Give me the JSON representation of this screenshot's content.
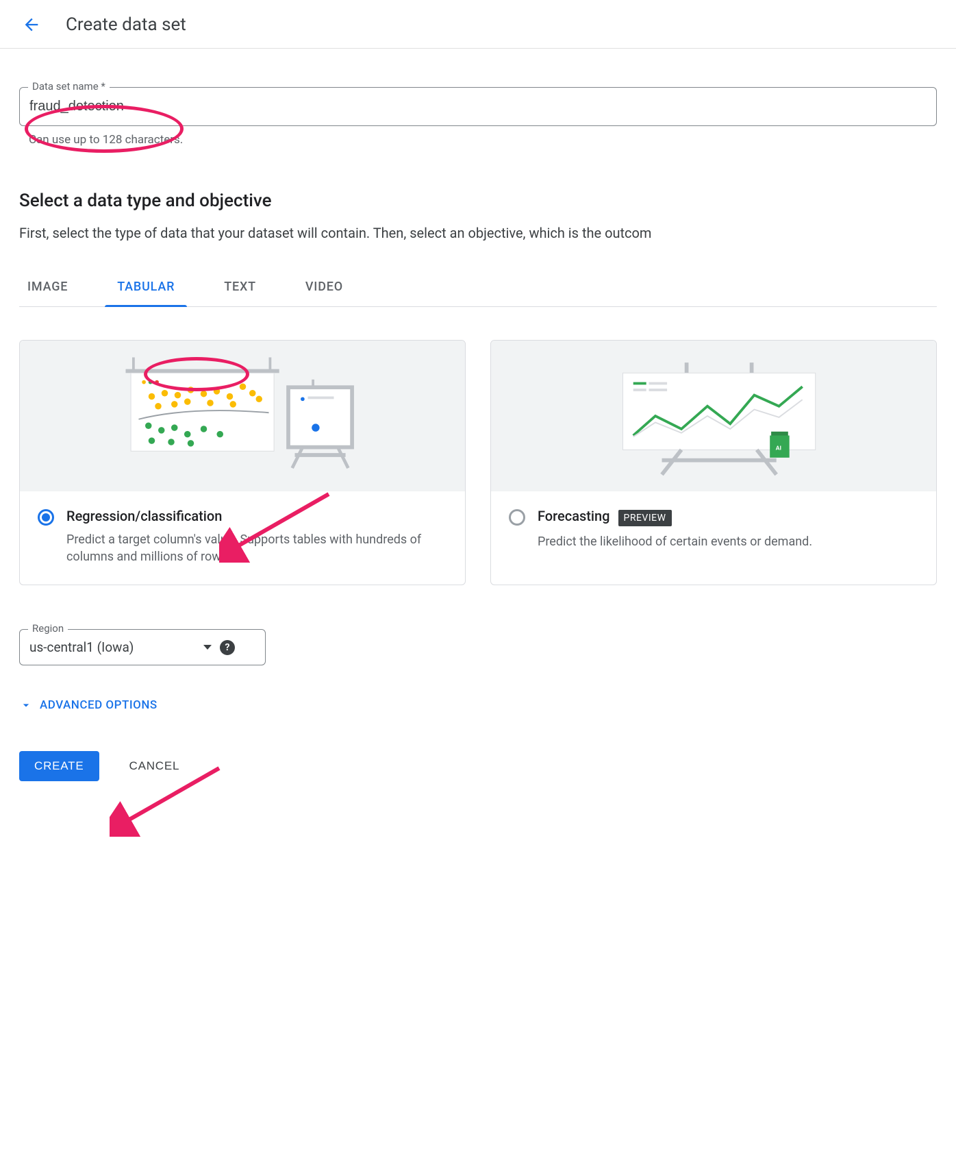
{
  "header": {
    "title": "Create data set"
  },
  "nameField": {
    "label": "Data set name *",
    "value": "fraud_detection",
    "hint": "Can use up to 128 characters."
  },
  "section": {
    "title": "Select a data type and objective",
    "description": "First, select the type of data that your dataset will contain. Then, select an objective, which is the outcom"
  },
  "tabs": [
    "IMAGE",
    "TABULAR",
    "TEXT",
    "VIDEO"
  ],
  "activeTab": "TABULAR",
  "cards": [
    {
      "title": "Regression/classification",
      "description": "Predict a target column's value. Supports tables with hundreds of columns and millions of rows.",
      "selected": true
    },
    {
      "title": "Forecasting",
      "badge": "PREVIEW",
      "description": "Predict the likelihood of certain events or demand.",
      "selected": false
    }
  ],
  "region": {
    "label": "Region",
    "value": "us-central1 (Iowa)"
  },
  "advanced": "ADVANCED OPTIONS",
  "buttons": {
    "create": "CREATE",
    "cancel": "CANCEL"
  }
}
